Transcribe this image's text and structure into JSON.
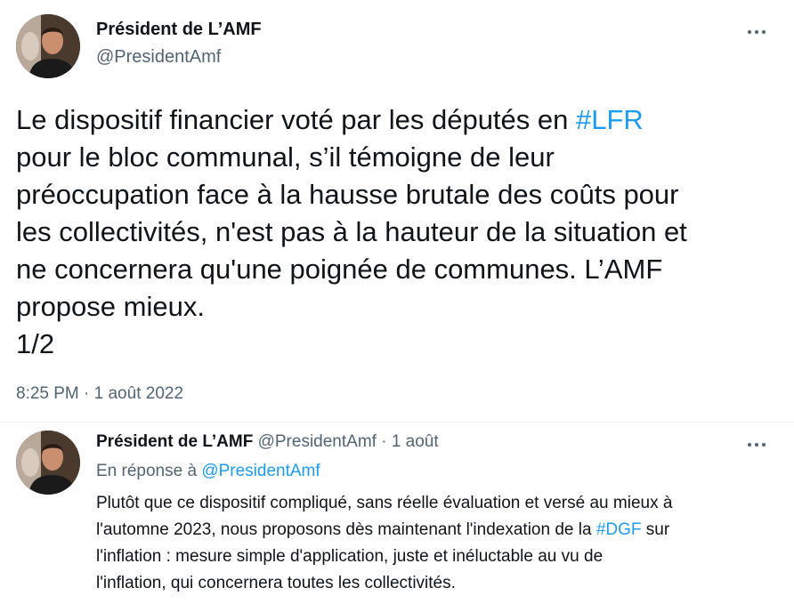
{
  "main_tweet": {
    "author_name": "Président de L’AMF",
    "handle": "@PresidentAmf",
    "text_lines": [
      {
        "before": "Le dispositif financier voté par les députés en ",
        "hashtag": "#LFR",
        "after": ""
      },
      {
        "before": "pour le bloc communal, s’il témoigne de leur",
        "hashtag": "",
        "after": ""
      },
      {
        "before": "préoccupation face à la hausse brutale des coûts pour",
        "hashtag": "",
        "after": ""
      },
      {
        "before": "les collectivités, n'est pas à la hauteur de la situation et",
        "hashtag": "",
        "after": ""
      },
      {
        "before": "ne concernera qu'une poignée de communes. L’AMF",
        "hashtag": "",
        "after": ""
      },
      {
        "before": "propose mieux.",
        "hashtag": "",
        "after": ""
      },
      {
        "before": "1/2",
        "hashtag": "",
        "after": ""
      }
    ],
    "timestamp": "8:25 PM · 1 août 2022"
  },
  "reply_tweet": {
    "author_name": "Président de L’AMF",
    "handle": "@PresidentAmf",
    "separator": "·",
    "date": "1 août",
    "reply_prefix": "En réponse à ",
    "reply_mention": "@PresidentAmf",
    "text_lines": [
      {
        "before": "Plutôt que ce dispositif compliqué, sans réelle évaluation et versé au mieux à",
        "hashtag": "",
        "after": ""
      },
      {
        "before": "l'automne 2023, nous proposons dès maintenant l'indexation de la ",
        "hashtag": "#DGF",
        "after": " sur"
      },
      {
        "before": "l'inflation : mesure simple d'application, juste et inéluctable au vu de",
        "hashtag": "",
        "after": ""
      },
      {
        "before": "l'inflation, qui concernera toutes les collectivités.",
        "hashtag": "",
        "after": ""
      }
    ]
  },
  "icons": {
    "more": "more-horizontal-icon",
    "avatar": "profile-photo"
  },
  "colors": {
    "text": "#0f1419",
    "secondary": "#536471",
    "link": "#1d9bf0",
    "divider": "#eff3f4"
  }
}
